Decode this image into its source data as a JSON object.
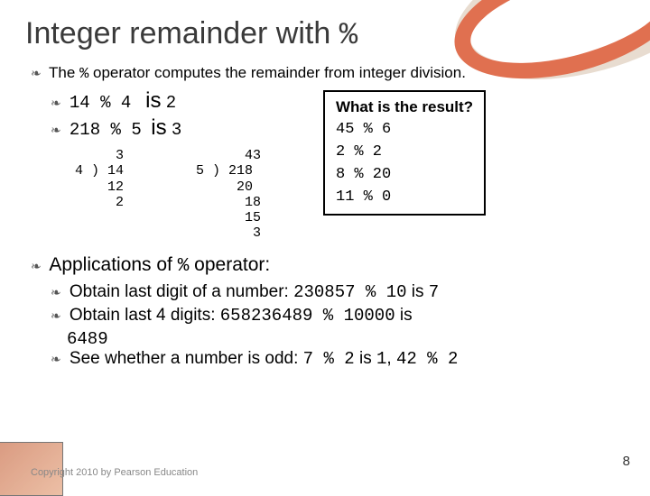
{
  "title_pre": "Integer remainder with ",
  "title_op": "%",
  "intro_pre": "The ",
  "intro_op": "%",
  "intro_post": " operator computes the remainder from integer division.",
  "ex1_expr": "14 % 4",
  "ex1_is": "is",
  "ex1_res": "2",
  "ex2_expr": "218 % 5",
  "ex2_is": "is",
  "ex2_res": "3",
  "longdiv1": "     3\n4 ) 14\n    12\n     2",
  "longdiv2": "      43\n5 ) 218\n     20\n      18\n      15\n       3",
  "box_q": "What is the result?",
  "box_l1": "45 % 6",
  "box_l2": "2 % 2",
  "box_l3": "8 % 20",
  "box_l4": "11 % 0",
  "apps_head_pre": "Applications of ",
  "apps_head_op": "%",
  "apps_head_post": " operator:",
  "app1_pre": "Obtain last digit of a number:  ",
  "app1_expr": "230857 % 10",
  "app1_is": " is ",
  "app1_res": "7",
  "app2_pre": "Obtain last 4 digits:     ",
  "app2_expr": "658236489 % 10000",
  "app2_is": " is",
  "app2_res": "6489",
  "app3_pre": "See whether a number is odd: ",
  "app3_e1": "7 % 2",
  "app3_is1": " is ",
  "app3_r1": "1",
  "app3_sep": ", ",
  "app3_e2": "42 % 2",
  "copyright": "Copyright 2010 by Pearson Education",
  "pagenum": "8"
}
